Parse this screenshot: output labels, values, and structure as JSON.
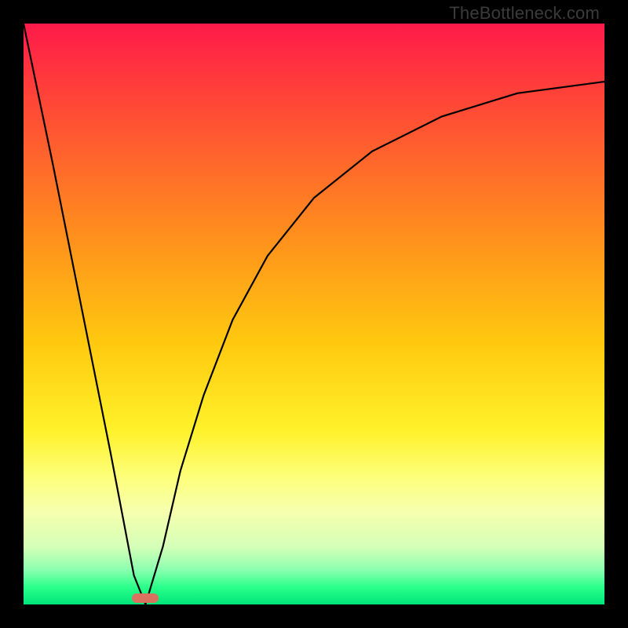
{
  "watermark": "TheBottleneck.com",
  "chart_data": {
    "type": "line",
    "title": "",
    "xlabel": "",
    "ylabel": "",
    "xlim": [
      0,
      1
    ],
    "ylim": [
      0,
      1
    ],
    "grid": false,
    "series": [
      {
        "name": "left-branch",
        "x": [
          0.0,
          0.05,
          0.1,
          0.15,
          0.19,
          0.21
        ],
        "values": [
          1.0,
          0.76,
          0.51,
          0.26,
          0.05,
          0.0
        ]
      },
      {
        "name": "right-branch",
        "x": [
          0.21,
          0.24,
          0.27,
          0.31,
          0.36,
          0.42,
          0.5,
          0.6,
          0.72,
          0.85,
          1.0
        ],
        "values": [
          0.0,
          0.1,
          0.23,
          0.36,
          0.49,
          0.6,
          0.7,
          0.78,
          0.84,
          0.88,
          0.9
        ]
      }
    ],
    "marker": {
      "x_center": 0.21,
      "y": 0.0,
      "width_frac": 0.046
    },
    "background_gradient": {
      "stops": [
        {
          "pos": 0.0,
          "color": "#ff1a4a"
        },
        {
          "pos": 0.25,
          "color": "#ff6b2a"
        },
        {
          "pos": 0.55,
          "color": "#ffc90f"
        },
        {
          "pos": 0.78,
          "color": "#fdff7a"
        },
        {
          "pos": 0.94,
          "color": "#8cffb0"
        },
        {
          "pos": 1.0,
          "color": "#00e67a"
        }
      ]
    }
  }
}
